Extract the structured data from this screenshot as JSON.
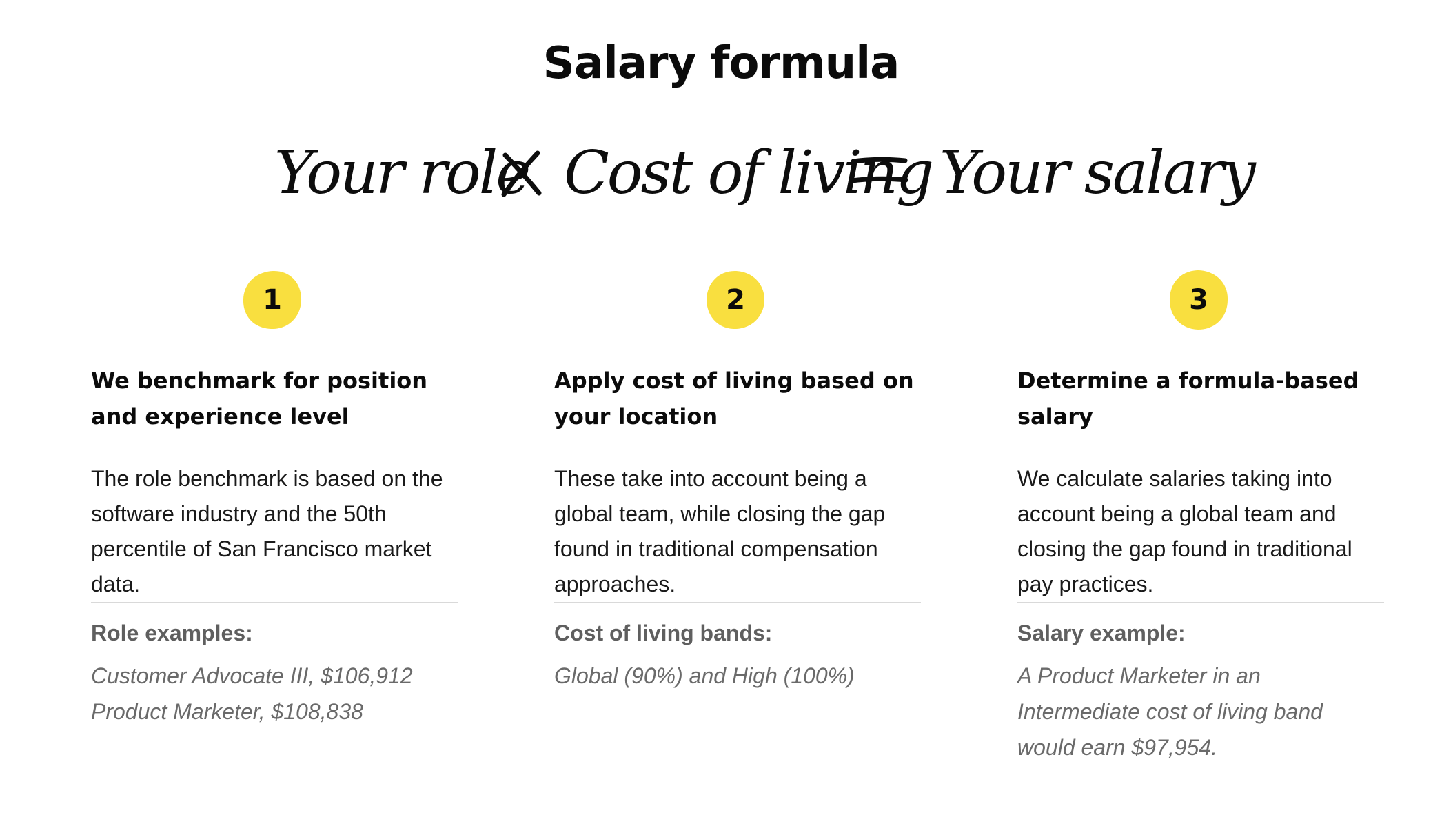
{
  "page": {
    "title": "Salary formula"
  },
  "formula": {
    "term_1": "Your role",
    "operator_1": "×",
    "term_2": "Cost of living",
    "operator_2": "=",
    "result": "Your salary"
  },
  "colors": {
    "badge": "#f9df3f",
    "heading": "#0b0b0b",
    "body_text": "#1a1a1a",
    "label_text": "#5f5f5f",
    "example_text": "#6a6a6a",
    "divider": "#d9d9d9"
  },
  "steps": [
    {
      "number": "1",
      "heading": "We benchmark for position and experience level",
      "body": "The role benchmark is based on the software industry and the 50th percentile of San Francisco market data.",
      "label": "Role examples:",
      "examples": [
        "Customer Advocate III, $106,912",
        "Product Marketer, $108,838"
      ]
    },
    {
      "number": "2",
      "heading": "Apply cost of living based on your location",
      "body": "These take into account being a global team, while closing the gap found in traditional compensation approaches.",
      "label": "Cost of living bands:",
      "examples": [
        "Global (90%) and High (100%)"
      ]
    },
    {
      "number": "3",
      "heading": "Determine a formula-based salary",
      "body": "We calculate salaries taking into account being a global team and closing the gap found in traditional pay practices.",
      "label": "Salary example:",
      "examples": [
        "A Product Marketer in an Intermediate cost of living band would earn $97,954."
      ]
    }
  ]
}
